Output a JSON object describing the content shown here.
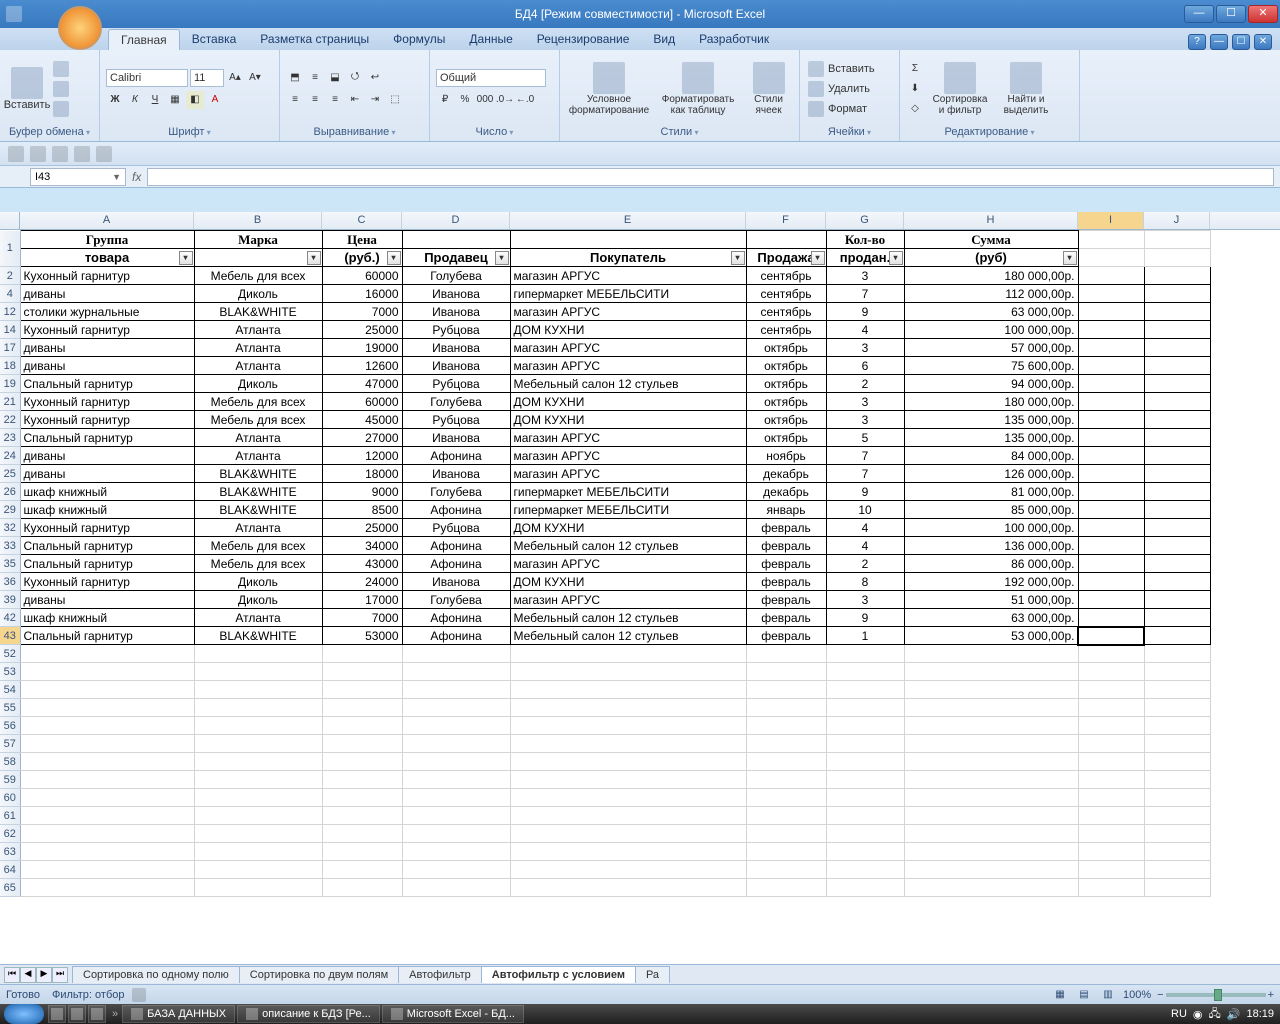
{
  "window": {
    "title": "БД4  [Режим совместимости] - Microsoft Excel"
  },
  "ribbon": {
    "tabs": [
      "Главная",
      "Вставка",
      "Разметка страницы",
      "Формулы",
      "Данные",
      "Рецензирование",
      "Вид",
      "Разработчик"
    ],
    "active_tab": "Главная",
    "groups": {
      "clipboard": "Буфер обмена",
      "font": "Шрифт",
      "alignment": "Выравнивание",
      "number": "Число",
      "styles": "Стили",
      "cells": "Ячейки",
      "editing": "Редактирование"
    },
    "paste": "Вставить",
    "font_name": "Calibri",
    "font_size": "11",
    "number_format": "Общий",
    "cond_fmt": "Условное\nформатирование",
    "fmt_table": "Форматировать\nкак таблицу",
    "cell_styles": "Стили\nячеек",
    "insert": "Вставить",
    "delete": "Удалить",
    "format": "Формат",
    "sort": "Сортировка\nи фильтр",
    "find": "Найти и\nвыделить"
  },
  "namebox": "I43",
  "columns": [
    "A",
    "B",
    "C",
    "D",
    "E",
    "F",
    "G",
    "H",
    "I",
    "J"
  ],
  "col_widths": [
    "colA",
    "colB",
    "colC",
    "colD",
    "colE",
    "colF",
    "colG",
    "colH",
    "colI",
    "colJ"
  ],
  "header1": [
    "Группа",
    "Марка",
    "Цена",
    "",
    "",
    "",
    "Кол-во",
    "Сумма"
  ],
  "header2": [
    "товара",
    "",
    "(руб.)",
    "Продавец",
    "Покупатель",
    "Продажа",
    "продан.",
    "(руб)"
  ],
  "rows": [
    {
      "n": 2,
      "d": [
        "Кухонный гарнитур",
        "Мебель для всех",
        "60000",
        "Голубева",
        "магазин АРГУС",
        "сентябрь",
        "3",
        "180 000,00р."
      ]
    },
    {
      "n": 4,
      "d": [
        "диваны",
        "Диколь",
        "16000",
        "Иванова",
        "гипермаркет МЕБЕЛЬСИТИ",
        "сентябрь",
        "7",
        "112 000,00р."
      ]
    },
    {
      "n": 12,
      "d": [
        "столики журнальные",
        "BLAK&WHITE",
        "7000",
        "Иванова",
        "магазин АРГУС",
        "сентябрь",
        "9",
        "63 000,00р."
      ]
    },
    {
      "n": 14,
      "d": [
        "Кухонный гарнитур",
        "Атланта",
        "25000",
        "Рубцова",
        "ДОМ КУХНИ",
        "сентябрь",
        "4",
        "100 000,00р."
      ]
    },
    {
      "n": 17,
      "d": [
        "диваны",
        "Атланта",
        "19000",
        "Иванова",
        "магазин АРГУС",
        "октябрь",
        "3",
        "57 000,00р."
      ]
    },
    {
      "n": 18,
      "d": [
        "диваны",
        "Атланта",
        "12600",
        "Иванова",
        "магазин АРГУС",
        "октябрь",
        "6",
        "75 600,00р."
      ]
    },
    {
      "n": 19,
      "d": [
        "Спальный гарнитур",
        "Диколь",
        "47000",
        "Рубцова",
        "Мебельный салон 12 стульев",
        "октябрь",
        "2",
        "94 000,00р."
      ]
    },
    {
      "n": 21,
      "d": [
        "Кухонный гарнитур",
        "Мебель для всех",
        "60000",
        "Голубева",
        "ДОМ КУХНИ",
        "октябрь",
        "3",
        "180 000,00р."
      ]
    },
    {
      "n": 22,
      "d": [
        "Кухонный гарнитур",
        "Мебель для всех",
        "45000",
        "Рубцова",
        "ДОМ КУХНИ",
        "октябрь",
        "3",
        "135 000,00р."
      ]
    },
    {
      "n": 23,
      "d": [
        "Спальный гарнитур",
        "Атланта",
        "27000",
        "Иванова",
        "магазин АРГУС",
        "октябрь",
        "5",
        "135 000,00р."
      ]
    },
    {
      "n": 24,
      "d": [
        "диваны",
        "Атланта",
        "12000",
        "Афонина",
        "магазин АРГУС",
        "ноябрь",
        "7",
        "84 000,00р."
      ]
    },
    {
      "n": 25,
      "d": [
        "диваны",
        "BLAK&WHITE",
        "18000",
        "Иванова",
        "магазин АРГУС",
        "декабрь",
        "7",
        "126 000,00р."
      ]
    },
    {
      "n": 26,
      "d": [
        "шкаф книжный",
        "BLAK&WHITE",
        "9000",
        "Голубева",
        "гипермаркет МЕБЕЛЬСИТИ",
        "декабрь",
        "9",
        "81 000,00р."
      ]
    },
    {
      "n": 29,
      "d": [
        "шкаф книжный",
        "BLAK&WHITE",
        "8500",
        "Афонина",
        "гипермаркет МЕБЕЛЬСИТИ",
        "январь",
        "10",
        "85 000,00р."
      ]
    },
    {
      "n": 32,
      "d": [
        "Кухонный гарнитур",
        "Атланта",
        "25000",
        "Рубцова",
        "ДОМ КУХНИ",
        "февраль",
        "4",
        "100 000,00р."
      ]
    },
    {
      "n": 33,
      "d": [
        "Спальный гарнитур",
        "Мебель для всех",
        "34000",
        "Афонина",
        "Мебельный салон 12 стульев",
        "февраль",
        "4",
        "136 000,00р."
      ]
    },
    {
      "n": 35,
      "d": [
        "Спальный гарнитур",
        "Мебель для всех",
        "43000",
        "Афонина",
        "магазин АРГУС",
        "февраль",
        "2",
        "86 000,00р."
      ]
    },
    {
      "n": 36,
      "d": [
        "Кухонный гарнитур",
        "Диколь",
        "24000",
        "Иванова",
        "ДОМ КУХНИ",
        "февраль",
        "8",
        "192 000,00р."
      ]
    },
    {
      "n": 39,
      "d": [
        "диваны",
        "Диколь",
        "17000",
        "Голубева",
        "магазин АРГУС",
        "февраль",
        "3",
        "51 000,00р."
      ]
    },
    {
      "n": 42,
      "d": [
        "шкаф книжный",
        "Атланта",
        "7000",
        "Афонина",
        "Мебельный салон 12 стульев",
        "февраль",
        "9",
        "63 000,00р."
      ]
    },
    {
      "n": 43,
      "d": [
        "Спальный гарнитур",
        "BLAK&WHITE",
        "53000",
        "Афонина",
        "Мебельный салон 12 стульев",
        "февраль",
        "1",
        "53 000,00р."
      ]
    }
  ],
  "empty_rows": [
    52,
    53,
    54,
    55,
    56,
    57,
    58,
    59,
    60,
    61,
    62,
    63,
    64,
    65
  ],
  "sheet_tabs": [
    "Сортировка по одному полю",
    "Сортировка по двум полям",
    "Автофильтр",
    "Автофильтр с условием",
    "Ра"
  ],
  "active_sheet": "Автофильтр с условием",
  "status": {
    "ready": "Готово",
    "filter": "Фильтр: отбор",
    "zoom": "100%"
  },
  "taskbar": {
    "items": [
      "БАЗА ДАННЫХ",
      "описание к БДЗ [Ре...",
      "Microsoft Excel - БД..."
    ],
    "lang": "RU",
    "time": "18:19"
  }
}
